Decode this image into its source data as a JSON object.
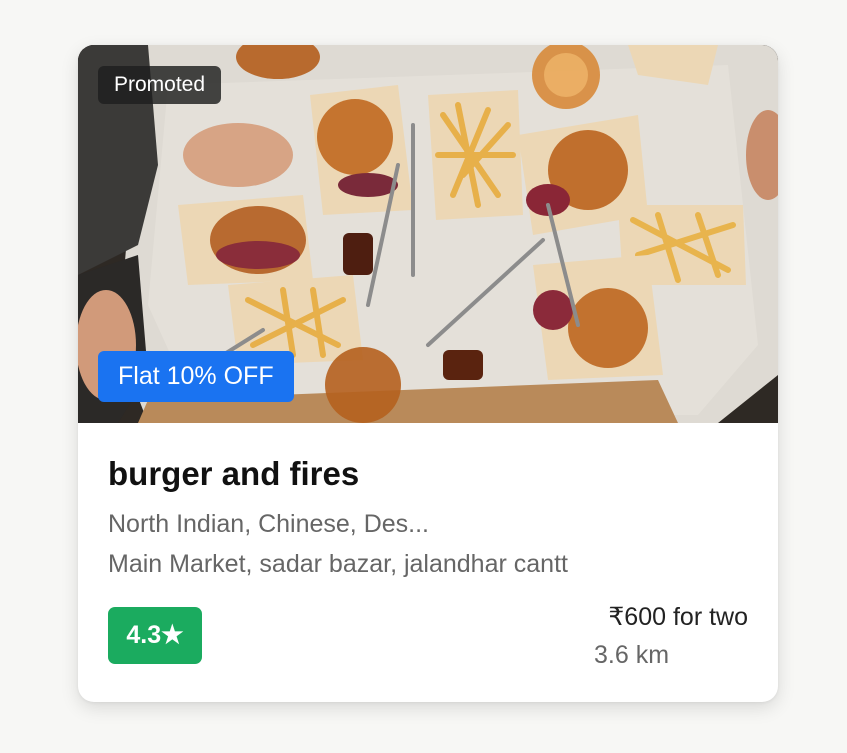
{
  "card": {
    "badges": {
      "promoted": "Promoted",
      "offer": "Flat 10% OFF"
    },
    "restaurant": {
      "name": "burger and fires",
      "cuisines": "North Indian, Chinese, Des...",
      "address": "Main Market, sadar bazar, jalandhar cantt"
    },
    "rating": {
      "value": "4.3★",
      "color": "#1bab5f"
    },
    "price": "₹600 for two",
    "distance": "3.6 km",
    "colors": {
      "offer_badge": "#1a73f1",
      "promoted_badge": "#1e1e1e"
    }
  }
}
